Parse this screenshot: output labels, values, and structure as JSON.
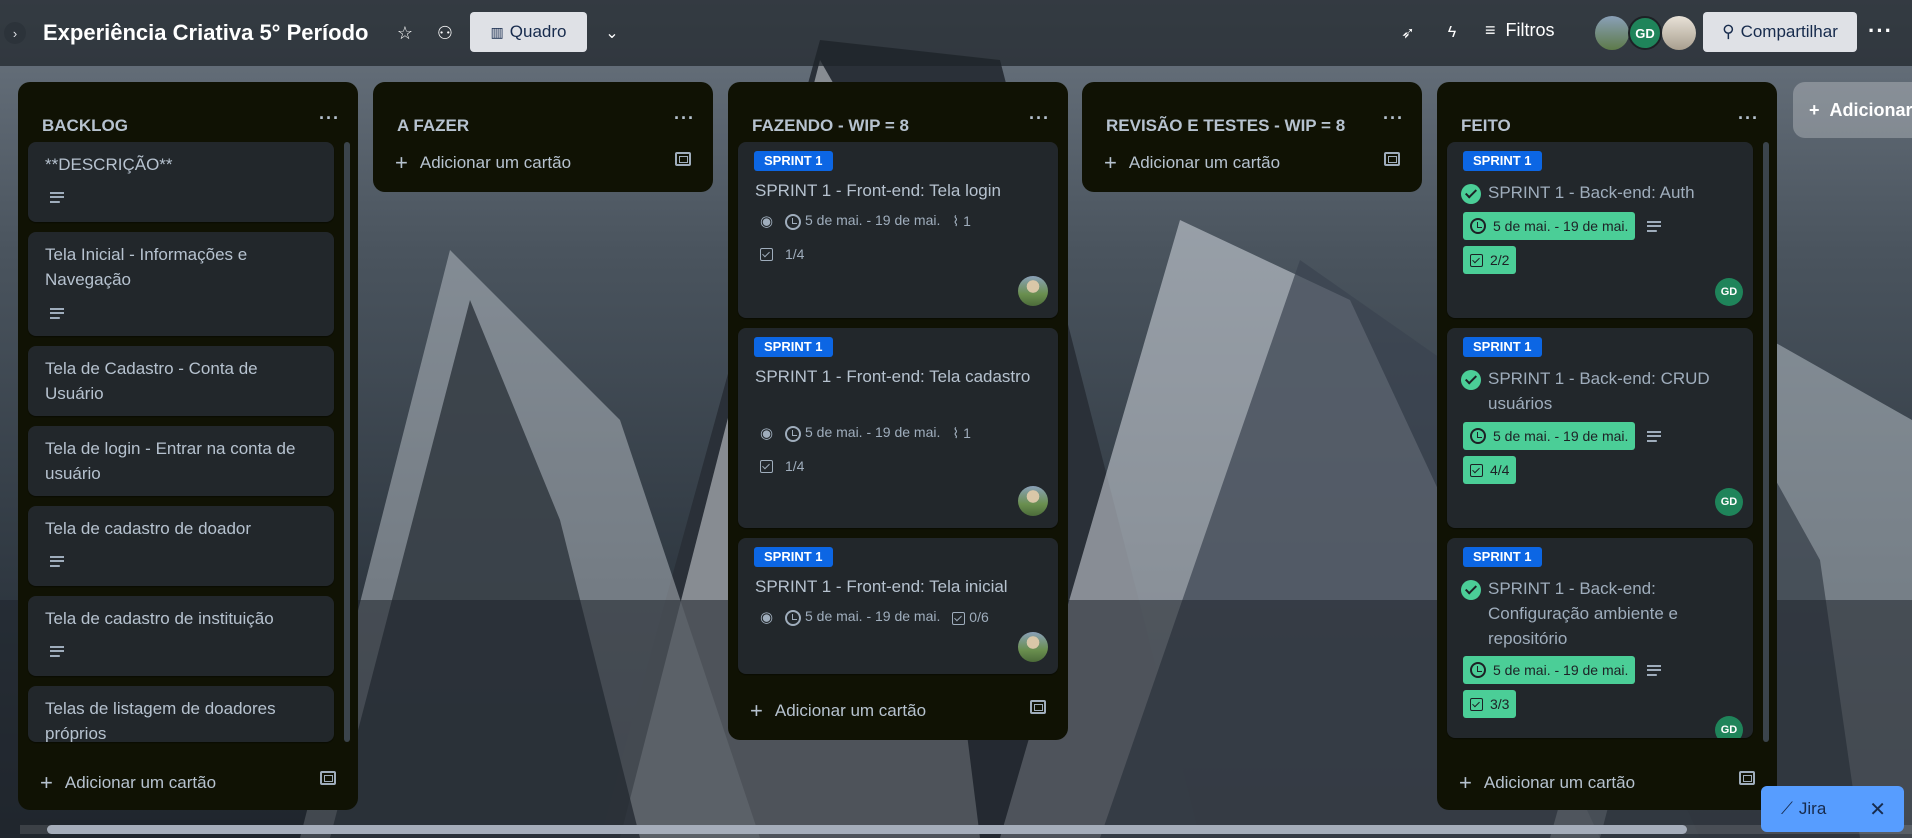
{
  "header": {
    "collapse_icon": "chevron-right",
    "title": "Experiência Criativa 5° Período",
    "view_label": "Quadro",
    "filters_label": "Filtros",
    "share_label": "Compartilhar",
    "avatar_gd": "GD"
  },
  "add_list_label": "Adicionar",
  "jira_label": "Jira",
  "lists": [
    {
      "title": "BACKLOG",
      "add_card": "Adicionar um cartão",
      "cards": [
        {
          "title": "**DESCRIÇÃO**"
        },
        {
          "title": "Tela Inicial - Informações e Navegação"
        },
        {
          "title": "Tela de Cadastro - Conta de Usuário"
        },
        {
          "title": "Tela de login - Entrar na conta de usuário"
        },
        {
          "title": "Tela de cadastro de doador"
        },
        {
          "title": "Tela de cadastro de instituição"
        },
        {
          "title": "Telas de listagem de doadores próprios"
        }
      ]
    },
    {
      "title": "A FAZER",
      "add_card": "Adicionar um cartão",
      "cards": []
    },
    {
      "title": "FAZENDO - WIP = 8",
      "add_card": "Adicionar um cartão",
      "cards": [
        {
          "label": "SPRINT 1",
          "title": "SPRINT 1 - Front-end: Tela login",
          "dates": "5 de mai. - 19 de mai.",
          "attachments": "1",
          "checklist": "1/4"
        },
        {
          "label": "SPRINT 1",
          "title": "SPRINT 1 - Front-end: Tela cadastro",
          "dates": "5 de mai. - 19 de mai.",
          "attachments": "1",
          "checklist": "1/4"
        },
        {
          "label": "SPRINT 1",
          "title": "SPRINT 1 - Front-end: Tela inicial",
          "dates": "5 de mai. - 19 de mai.",
          "checklist": "0/6"
        }
      ]
    },
    {
      "title": "REVISÃO E TESTES - WIP = 8",
      "add_card": "Adicionar um cartão",
      "cards": []
    },
    {
      "title": "FEITO",
      "add_card": "Adicionar um cartão",
      "cards": [
        {
          "label": "SPRINT 1",
          "title": "SPRINT 1 - Back-end: Auth",
          "dates": "5 de mai. - 19 de mai.",
          "checklist": "2/2",
          "member": "GD"
        },
        {
          "label": "SPRINT 1",
          "title": "SPRINT 1 - Back-end: CRUD usuários",
          "dates": "5 de mai. - 19 de mai.",
          "checklist": "4/4",
          "member": "GD"
        },
        {
          "label": "SPRINT 1",
          "title": "SPRINT 1 - Back-end: Configuração ambiente e repositório",
          "dates": "5 de mai. - 19 de mai.",
          "checklist": "3/3",
          "member": "GD"
        }
      ]
    }
  ],
  "colors": {
    "list_bg": "#101204",
    "card_bg": "#22272b",
    "label_blue": "#0c66e4",
    "complete_green": "#4bce97",
    "member_green": "#1f845a"
  }
}
